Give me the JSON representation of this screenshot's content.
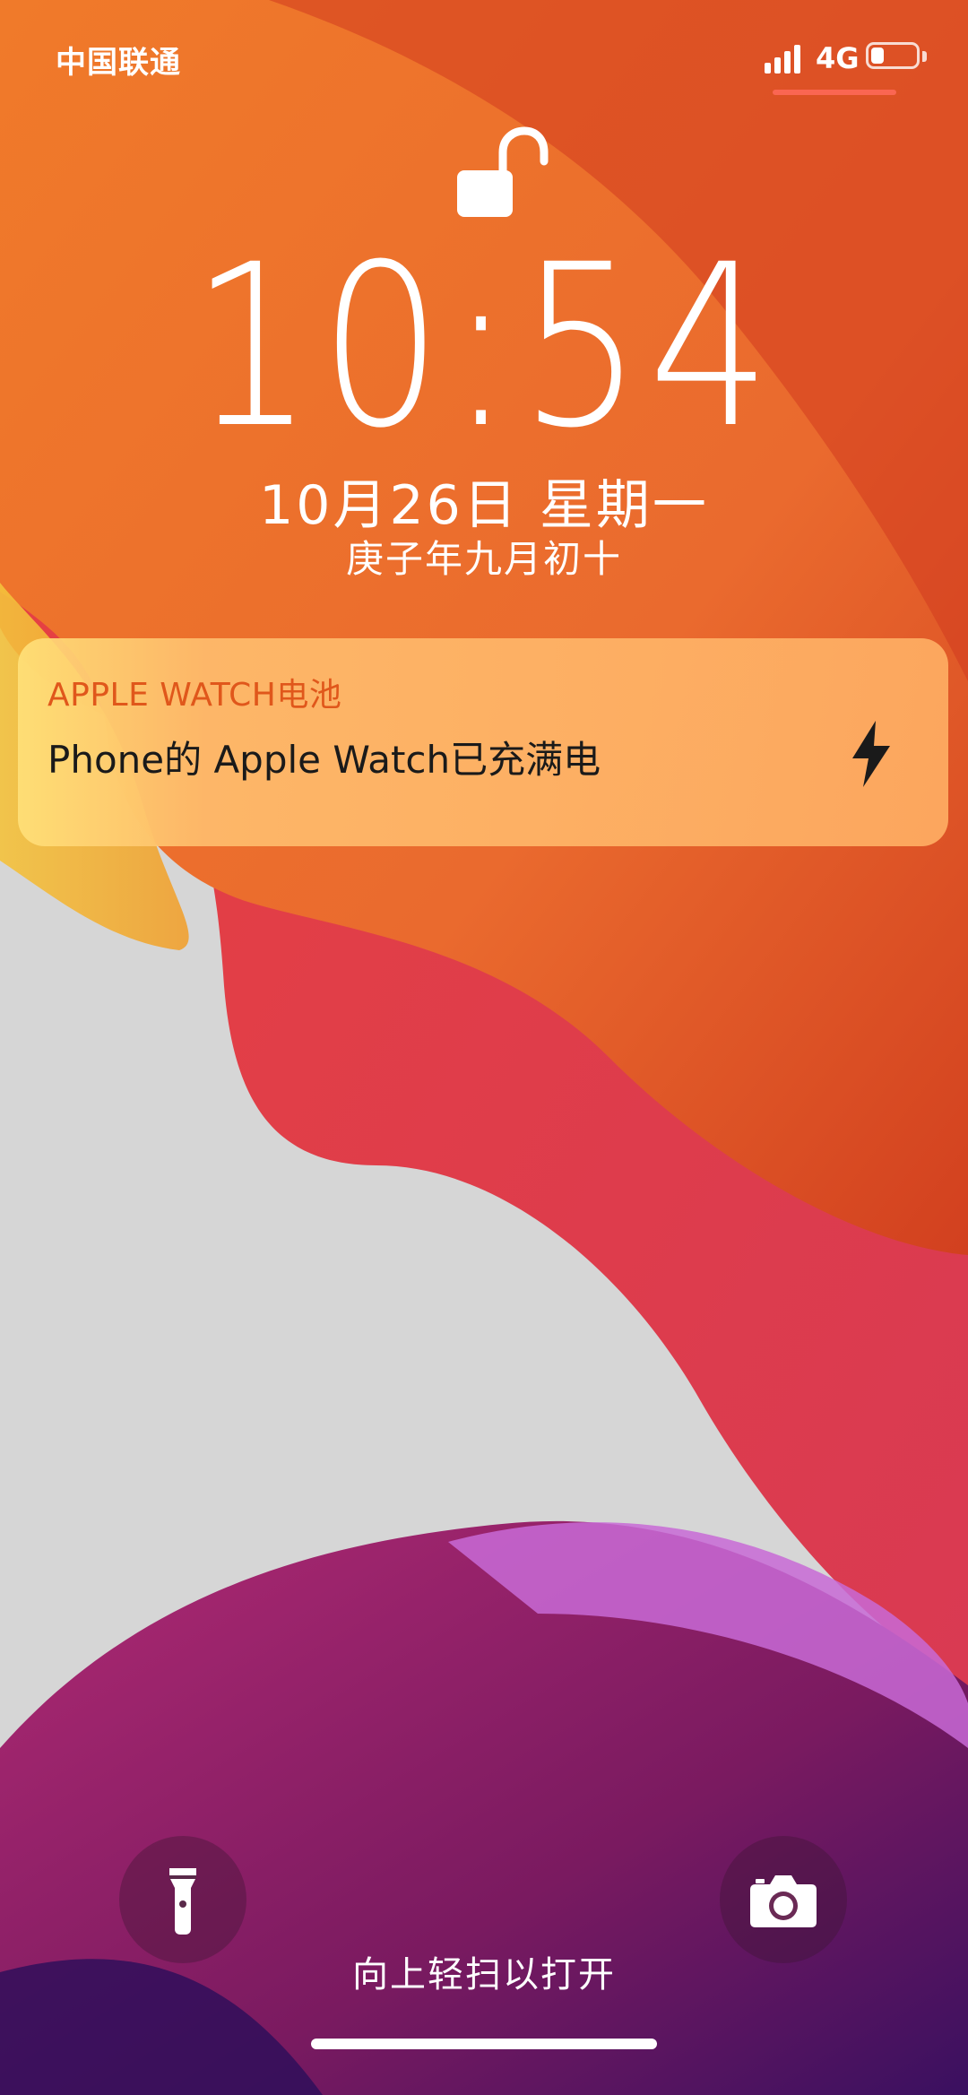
{
  "status_bar": {
    "carrier": "中国联通",
    "network": "4G",
    "battery_level": 0.3,
    "signal_icon": "signal-bars-icon",
    "battery_icon": "battery-icon"
  },
  "lock_screen": {
    "lock_icon": "unlocked-padlock-icon",
    "time": "10:54",
    "date": "10月26日 星期一",
    "lunar_date": "庚子年九月初十"
  },
  "notification": {
    "app_name": "APPLE WATCH电池",
    "message": "Phone的 Apple Watch已充满电",
    "icon": "lightning-bolt-icon",
    "text_accent": "#e0571b"
  },
  "bottom": {
    "flashlight_icon": "flashlight-icon",
    "camera_icon": "camera-icon",
    "swipe_hint": "向上轻扫以打开"
  }
}
